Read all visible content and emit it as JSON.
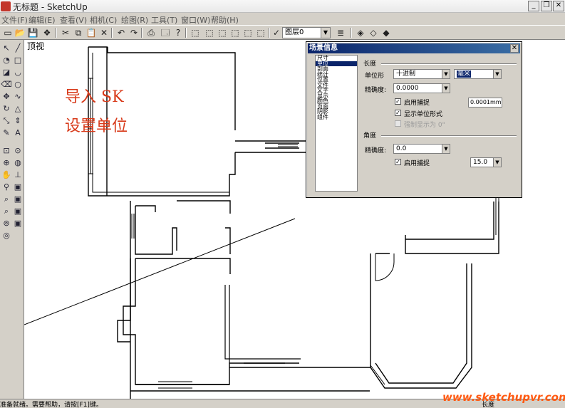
{
  "window": {
    "title": "无标题 - SketchUp"
  },
  "menu": [
    "文件(F)",
    "编辑(E)",
    "查看(V)",
    "相机(C)",
    "绘图(R)",
    "工具(T)",
    "窗口(W)",
    "帮助(H)"
  ],
  "toolbar": {
    "layer_name": "图层0"
  },
  "canvas": {
    "view_label": "顶视",
    "overlay_line1": "导入 SK",
    "overlay_line2": "设置单位"
  },
  "dialog": {
    "title": "场景信息",
    "categories": [
      "尺寸",
      "单位",
      "剖面",
      "统计",
      "位置",
      "文件",
      "文字",
      "显示",
      "颜色",
      "页面",
      "阴影",
      "组件"
    ],
    "selected_category": "单位",
    "length": {
      "section_label": "长度",
      "format_label": "单位形",
      "format_value": "十进制",
      "unit_value": "毫米",
      "precision_label": "精确度:",
      "precision_value": "0.0000",
      "enable_snap_label": "启用捕捉",
      "snap_value": "0.0001mm",
      "display_units_label": "显示单位形式",
      "force_display_label": "强制显示为 0\""
    },
    "angle": {
      "section_label": "角度",
      "precision_label": "精确度:",
      "precision_value": "0.0",
      "enable_snap_label": "启用捕捉",
      "snap_value": "15.0"
    }
  },
  "status": {
    "text": "准备就绪。需要帮助，请按[F1]键。",
    "right_label": "长度"
  },
  "watermark": "www.sketchupvr.com"
}
